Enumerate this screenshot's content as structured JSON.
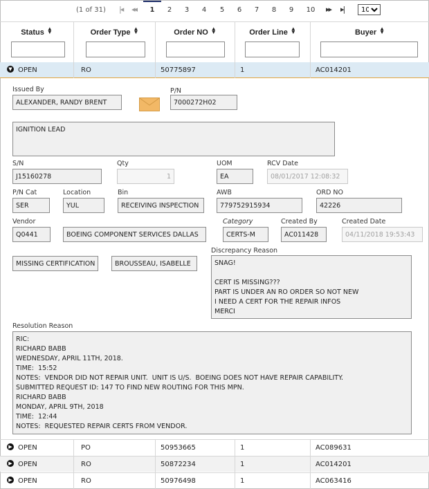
{
  "pager": {
    "info": "(1 of 31)",
    "first_glyph": "|◂",
    "prev_glyph": "◂◂",
    "next_glyph": "▸▸",
    "last_glyph": "▸|",
    "pages": [
      "1",
      "2",
      "3",
      "4",
      "5",
      "6",
      "7",
      "8",
      "9",
      "10"
    ],
    "active_page": "1",
    "page_size": "10",
    "page_size_options": [
      "10"
    ]
  },
  "columns": [
    {
      "label": "Status"
    },
    {
      "label": "Order Type"
    },
    {
      "label": "Order NO"
    },
    {
      "label": "Order Line"
    },
    {
      "label": "Buyer"
    }
  ],
  "expanded_row": {
    "status": "OPEN",
    "order_type": "RO",
    "order_no": "50775897",
    "order_line": "1",
    "buyer": "AC014201"
  },
  "detail": {
    "issued_by_label": "Issued By",
    "issued_by": "ALEXANDER, RANDY BRENT",
    "pn_label": "P/N",
    "pn": "7000272H02",
    "description": "IGNITION LEAD",
    "sn_label": "S/N",
    "sn": "J15160278",
    "qty_label": "Qty",
    "qty": "1",
    "uom_label": "UOM",
    "uom": "EA",
    "rcv_date_label": "RCV Date",
    "rcv_date": "08/01/2017 12:08:32",
    "pn_cat_label": "P/N Cat",
    "pn_cat": "SER",
    "location_label": "Location",
    "location": "YUL",
    "bin_label": "Bin",
    "bin": "RECEIVING INSPECTION",
    "awb_label": "AWB",
    "awb": "779752915934",
    "ord_no_label": "ORD NO",
    "ord_no": "42226",
    "vendor_label": "Vendor",
    "vendor_code": "Q0441",
    "vendor_name": "BOEING COMPONENT SERVICES DALLAS",
    "category_label": "Category",
    "category": "CERTS-M",
    "created_by_label": "Created By",
    "created_by": "AC011428",
    "created_date_label": "Created Date",
    "created_date": "04/11/2018 19:53:43",
    "missing": "MISSING CERTIFICATION",
    "assignee": "BROUSSEAU, ISABELLE",
    "discrepancy_label": "Discrepancy Reason",
    "discrepancy_lines": [
      "SNAG!",
      "",
      "CERT IS MISSING???",
      "PART IS UNDER AN RO ORDER SO NOT NEW",
      "I NEED A CERT FOR THE REPAIR INFOS",
      "MERCI"
    ],
    "resolution_label": "Resolution Reason",
    "resolution_lines": [
      "RIC:",
      "RICHARD BABB",
      "WEDNESDAY, APRIL 11TH, 2018.",
      "TIME:  15:52",
      "NOTES:  VENDOR DID NOT REPAIR UNIT.  UNIT IS U/S.  BOEING DOES NOT HAVE REPAIR CAPABILITY.",
      "SUBMITTED REQUEST ID: 147 TO FIND NEW ROUTING FOR THIS MPN.",
      "RICHARD BABB",
      "MONDAY, APRIL 9TH, 2018",
      "TIME:  12:44",
      "NOTES:  REQUESTED REPAIR CERTS FROM VENDOR."
    ]
  },
  "rows": [
    {
      "status": "OPEN",
      "order_type": "PO",
      "order_no": "50953665",
      "order_line": "1",
      "buyer": "AC089631"
    },
    {
      "status": "OPEN",
      "order_type": "RO",
      "order_no": "50872234",
      "order_line": "1",
      "buyer": "AC014201"
    },
    {
      "status": "OPEN",
      "order_type": "RO",
      "order_no": "50976498",
      "order_line": "1",
      "buyer": "AC063416"
    }
  ],
  "colors": {
    "expanded_row_bg": "#dceaf4",
    "expanded_row_border": "#e3a640",
    "envelope": "#f2b866",
    "active_page_bar": "#1f2f6b"
  },
  "icons": {
    "expand": "chevron-down-circle-icon",
    "collapse": "chevron-right-circle-icon",
    "mail": "envelope-icon",
    "sort": "sort-arrows-icon"
  }
}
